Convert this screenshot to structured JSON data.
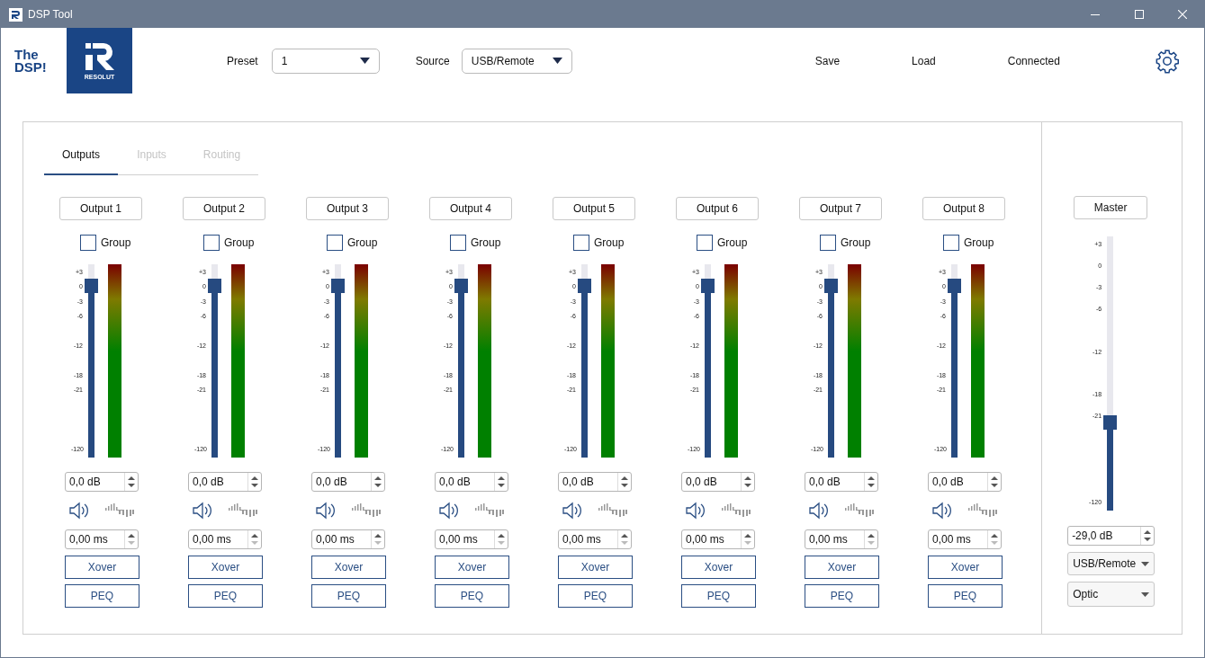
{
  "window": {
    "title": "DSP Tool"
  },
  "logo": {
    "lines": [
      "The",
      "DSP!"
    ],
    "badge_text": "RESOLUT"
  },
  "header": {
    "preset": {
      "label": "Preset",
      "value": "1"
    },
    "source": {
      "label": "Source",
      "value": "USB/Remote"
    },
    "actions": [
      "Save",
      "Load"
    ],
    "status": "Connected"
  },
  "tabs": [
    {
      "label": "Outputs",
      "selected": true
    },
    {
      "label": "Inputs",
      "selected": false
    },
    {
      "label": "Routing",
      "selected": false
    }
  ],
  "channels": [
    {
      "name": "Output 1",
      "group": {
        "label": "Group",
        "checked": false
      },
      "scale": [
        "+3",
        "0",
        "-3",
        "-6",
        "-12",
        "-18",
        "-21",
        "-120"
      ],
      "fader": {
        "level": 0.89
      },
      "meter": {
        "level": 1
      },
      "gain": "0,0 dB",
      "delay": "0,00 ms",
      "buttons": [
        "Xover",
        "PEQ"
      ]
    },
    {
      "name": "Output 2",
      "group": {
        "label": "Group",
        "checked": false
      },
      "scale": [
        "+3",
        "0",
        "-3",
        "-6",
        "-12",
        "-18",
        "-21",
        "-120"
      ],
      "fader": {
        "level": 0.89
      },
      "meter": {
        "level": 1
      },
      "gain": "0,0 dB",
      "delay": "0,00 ms",
      "buttons": [
        "Xover",
        "PEQ"
      ]
    },
    {
      "name": "Output 3",
      "group": {
        "label": "Group",
        "checked": false
      },
      "scale": [
        "+3",
        "0",
        "-3",
        "-6",
        "-12",
        "-18",
        "-21",
        "-120"
      ],
      "fader": {
        "level": 0.89
      },
      "meter": {
        "level": 1
      },
      "gain": "0,0 dB",
      "delay": "0,00 ms",
      "buttons": [
        "Xover",
        "PEQ"
      ]
    },
    {
      "name": "Output 4",
      "group": {
        "label": "Group",
        "checked": false
      },
      "scale": [
        "+3",
        "0",
        "-3",
        "-6",
        "-12",
        "-18",
        "-21",
        "-120"
      ],
      "fader": {
        "level": 0.89
      },
      "meter": {
        "level": 1
      },
      "gain": "0,0 dB",
      "delay": "0,00 ms",
      "buttons": [
        "Xover",
        "PEQ"
      ]
    },
    {
      "name": "Output 5",
      "group": {
        "label": "Group",
        "checked": false
      },
      "scale": [
        "+3",
        "0",
        "-3",
        "-6",
        "-12",
        "-18",
        "-21",
        "-120"
      ],
      "fader": {
        "level": 0.89
      },
      "meter": {
        "level": 1
      },
      "gain": "0,0 dB",
      "delay": "0,00 ms",
      "buttons": [
        "Xover",
        "PEQ"
      ]
    },
    {
      "name": "Output 6",
      "group": {
        "label": "Group",
        "checked": false
      },
      "scale": [
        "+3",
        "0",
        "-3",
        "-6",
        "-12",
        "-18",
        "-21",
        "-120"
      ],
      "fader": {
        "level": 0.89
      },
      "meter": {
        "level": 1
      },
      "gain": "0,0 dB",
      "delay": "0,00 ms",
      "buttons": [
        "Xover",
        "PEQ"
      ]
    },
    {
      "name": "Output 7",
      "group": {
        "label": "Group",
        "checked": false
      },
      "scale": [
        "+3",
        "0",
        "-3",
        "-6",
        "-12",
        "-18",
        "-21",
        "-120"
      ],
      "fader": {
        "level": 0.89
      },
      "meter": {
        "level": 1
      },
      "gain": "0,0 dB",
      "delay": "0,00 ms",
      "buttons": [
        "Xover",
        "PEQ"
      ]
    },
    {
      "name": "Output 8",
      "group": {
        "label": "Group",
        "checked": false
      },
      "scale": [
        "+3",
        "0",
        "-3",
        "-6",
        "-12",
        "-18",
        "-21",
        "-120"
      ],
      "fader": {
        "level": 0.89
      },
      "meter": {
        "level": 1
      },
      "gain": "0,0 dB",
      "delay": "0,00 ms",
      "buttons": [
        "Xover",
        "PEQ"
      ]
    }
  ],
  "master": {
    "name": "Master",
    "scale": [
      "+3",
      "0",
      "-3",
      "-6",
      "-12",
      "-18",
      "-21",
      "-120"
    ],
    "fader": {
      "level": 0.32
    },
    "gain": "-29,0 dB",
    "selects": [
      "USB/Remote",
      "Optic"
    ]
  }
}
